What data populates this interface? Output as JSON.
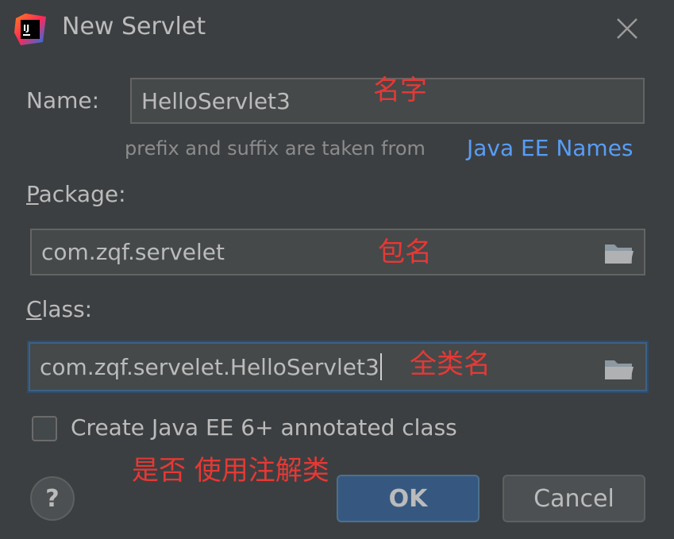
{
  "window": {
    "title": "New Servlet",
    "logo_text": "IJ"
  },
  "form": {
    "name_label": "Name:",
    "name_value": "HelloServlet3",
    "hint_text": "prefix and suffix are taken from",
    "hint_link": "Java EE Names",
    "package_label_first": "P",
    "package_label_rest": "ackage:",
    "package_value": "com.zqf.servelet",
    "class_label_first": "C",
    "class_label_rest": "lass:",
    "class_value": "com.zqf.servelet.HelloServlet3",
    "checkbox_label": "Create Java EE 6+ annotated class",
    "checkbox_checked": false
  },
  "annotations": {
    "name_note": "名字",
    "package_note": "包名",
    "class_note": "全类名",
    "checkbox_note": "是否 使用注解类"
  },
  "buttons": {
    "help": "?",
    "ok": "OK",
    "cancel": "Cancel"
  },
  "colors": {
    "background": "#3c3f41",
    "link": "#589df6",
    "annotation": "#e53935",
    "ok_button": "#365880"
  }
}
